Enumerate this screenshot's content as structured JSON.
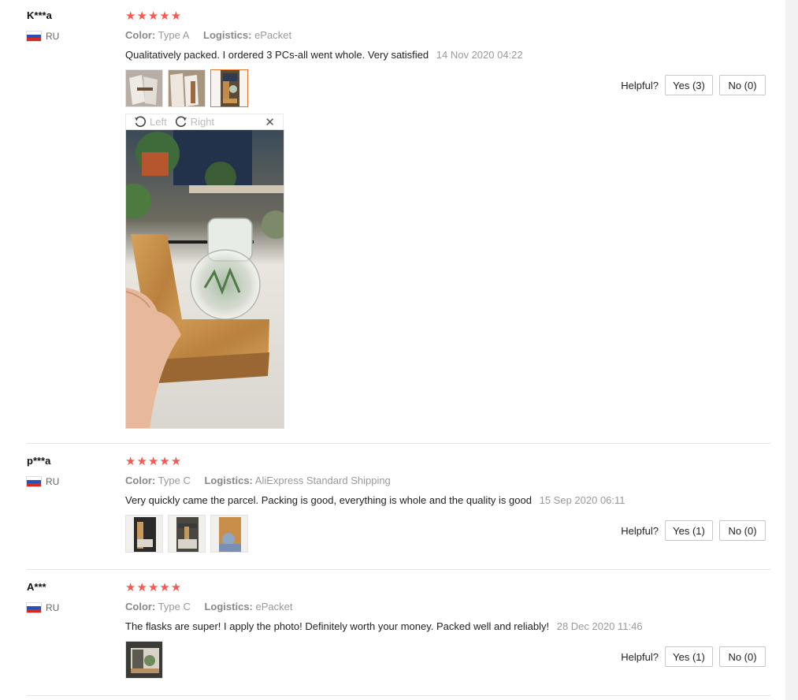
{
  "reviews": [
    {
      "user": "K***a",
      "country": "RU",
      "stars": "★★★★★",
      "color_label": "Color:",
      "color_value": "Type A",
      "logistics_label": "Logistics:",
      "logistics_value": "ePacket",
      "text": "Qualitatively packed. I ordered 3 PCs-all went whole. Very satisfied",
      "date": "14 Nov 2020 04:22",
      "helpful_label": "Helpful?",
      "yes_label": "Yes (3)",
      "no_label": "No (0)"
    },
    {
      "user": "p***a",
      "country": "RU",
      "stars": "★★★★★",
      "color_label": "Color:",
      "color_value": "Type C",
      "logistics_label": "Logistics:",
      "logistics_value": "AliExpress Standard Shipping",
      "text": "Very quickly came the parcel. Packing is good, everything is whole and the quality is good",
      "date": "15 Sep 2020 06:11",
      "helpful_label": "Helpful?",
      "yes_label": "Yes (1)",
      "no_label": "No (0)"
    },
    {
      "user": "A***",
      "country": "RU",
      "stars": "★★★★★",
      "color_label": "Color:",
      "color_value": "Type C",
      "logistics_label": "Logistics:",
      "logistics_value": "ePacket",
      "text": "The flasks are super! I apply the photo! Definitely worth your money. Packed well and reliably!",
      "date": "28 Dec 2020 11:46",
      "helpful_label": "Helpful?",
      "yes_label": "Yes (1)",
      "no_label": "No (0)"
    }
  ],
  "viewer": {
    "rotate_left_label": "Left",
    "rotate_right_label": "Right",
    "close_glyph": "✕"
  },
  "colors": {
    "star": "#f45a4f",
    "active_thumb_border": "#e8742c",
    "muted_text": "#999999"
  },
  "icons": [
    "rotate-left-icon",
    "rotate-right-icon",
    "close-icon",
    "star-icon",
    "flag-ru-icon"
  ]
}
